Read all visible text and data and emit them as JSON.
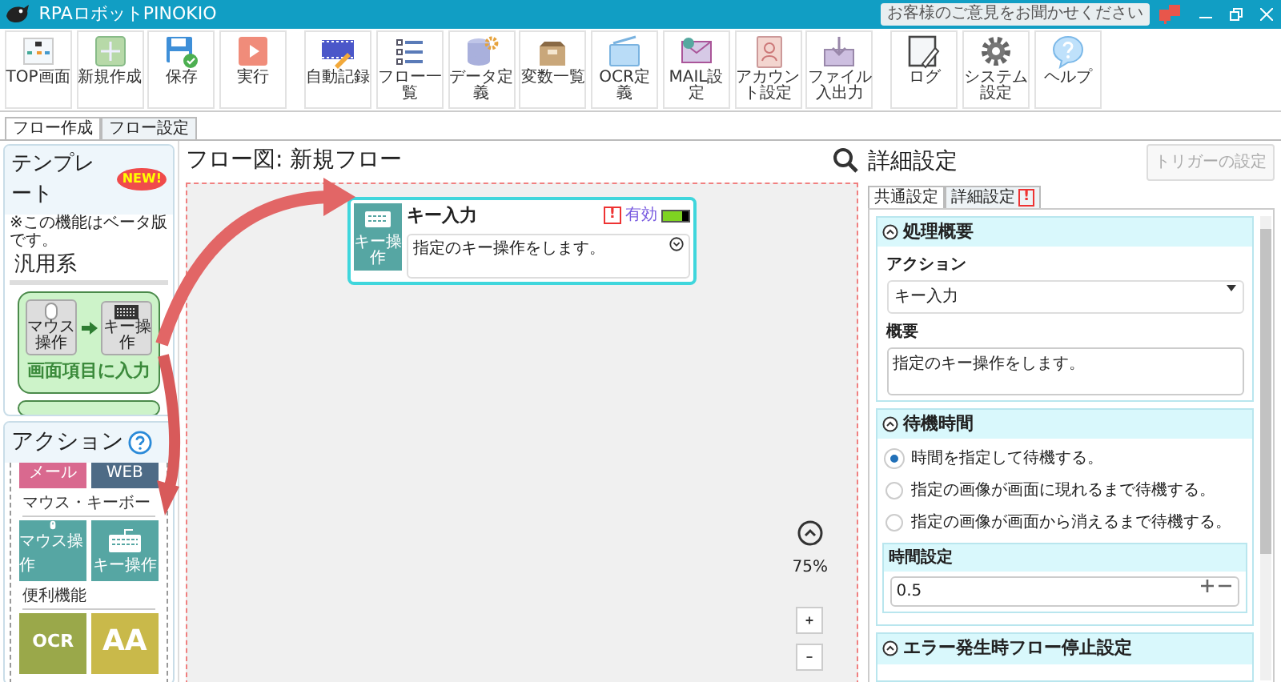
{
  "window": {
    "title": "RPAロボットPINOKIO",
    "feedback": "お客様のご意見をお聞かせください"
  },
  "toolbar_groups": [
    {
      "buttons": [
        {
          "kind": "top",
          "label": "TOP画面"
        },
        {
          "kind": "new",
          "label": "新規作成"
        },
        {
          "kind": "save",
          "label": "保存"
        },
        {
          "kind": "run",
          "label": "実行"
        }
      ]
    },
    {
      "buttons": [
        {
          "kind": "record",
          "label": "自動記録"
        },
        {
          "kind": "list",
          "label": "フロー一覧"
        },
        {
          "kind": "data",
          "label": "データ定義"
        },
        {
          "kind": "vars",
          "label": "変数一覧"
        },
        {
          "kind": "ocr",
          "label": "OCR定義"
        },
        {
          "kind": "mail",
          "label": "MAIL設定"
        },
        {
          "kind": "account",
          "label": "アカウント設定"
        },
        {
          "kind": "file",
          "label": "ファイル入出力"
        }
      ]
    },
    {
      "buttons": [
        {
          "kind": "log",
          "label": "ログ"
        },
        {
          "kind": "settings",
          "label": "システム設定"
        },
        {
          "kind": "help",
          "label": "ヘルプ"
        }
      ]
    }
  ],
  "main_tabs": [
    {
      "label": "フロー作成",
      "selected": true
    },
    {
      "label": "フロー設定",
      "selected": false
    }
  ],
  "template_panel": {
    "title": "テンプレート",
    "badge": "NEW!",
    "note": "※この機能はベータ版です。",
    "group": "汎用系",
    "cards": [
      {
        "from": "マウス操作",
        "to": "キー操作",
        "label": "画面項目に入力"
      }
    ]
  },
  "actions_panel": {
    "title": "アクション",
    "rows": [
      {
        "kind": "tiles",
        "tiles": [
          {
            "kind": "mail",
            "label": "メール",
            "color": "#d9698f"
          },
          {
            "kind": "web",
            "label": "WEB",
            "color": "#4e6b86"
          }
        ]
      },
      {
        "kind": "heading",
        "text": "マウス・キーボー"
      },
      {
        "kind": "tiles",
        "tiles": [
          {
            "kind": "mouse",
            "label": "マウス操作",
            "color": "#56a6a3"
          },
          {
            "kind": "keyboard",
            "label": "キー操作",
            "color": "#56a6a3"
          }
        ]
      },
      {
        "kind": "heading",
        "text": "便利機能"
      },
      {
        "kind": "tiles",
        "tiles": [
          {
            "kind": "ocr",
            "glyph": "OCR",
            "color": "#9aa84a"
          },
          {
            "kind": "font",
            "glyph": "AA",
            "color": "#c9b94a"
          }
        ]
      }
    ]
  },
  "flow": {
    "title": "フロー図: 新規フロー",
    "zoom": "75%",
    "nodes": [
      {
        "icon_label": "キー操作",
        "title": "キー入力",
        "error": true,
        "error_text": "!",
        "status": "有効",
        "enabled": true,
        "description": "指定のキー操作をします。"
      }
    ]
  },
  "details": {
    "title": "詳細設定",
    "trigger_button": "トリガーの設定",
    "tabs": [
      {
        "label": "共通設定",
        "selected": true,
        "error": false
      },
      {
        "label": "詳細設定",
        "selected": false,
        "error": true,
        "error_text": "!"
      }
    ],
    "summary": {
      "title": "処理概要",
      "action_label": "アクション",
      "action_value": "キー入力",
      "overview_label": "概要",
      "overview_value": "指定のキー操作をします。"
    },
    "wait": {
      "title": "待機時間",
      "options": [
        {
          "label": "時間を指定して待機する。",
          "selected": true
        },
        {
          "label": "指定の画像が画面に現れるまで待機する。",
          "selected": false
        },
        {
          "label": "指定の画像が画面から消えるまで待機する。",
          "selected": false
        }
      ],
      "time_label": "時間設定",
      "time_value": "0.5"
    },
    "error_section": {
      "title": "エラー発生時フロー停止設定"
    }
  }
}
